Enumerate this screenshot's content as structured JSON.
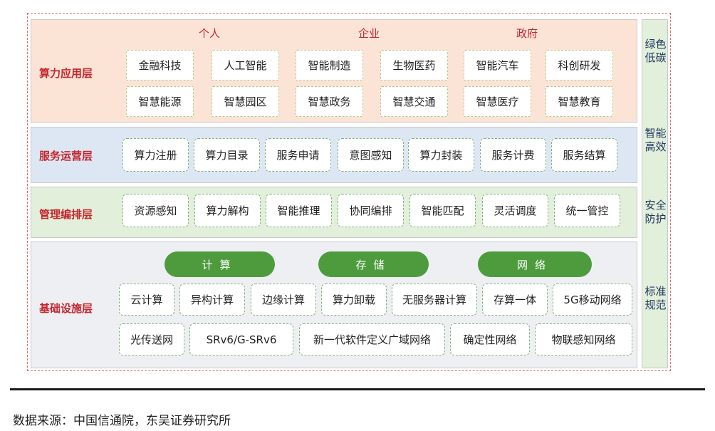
{
  "layers": {
    "application": {
      "label": "算力应用层",
      "groups": [
        "个人",
        "企业",
        "政府"
      ],
      "items": [
        "金融科技",
        "人工智能",
        "智能制造",
        "生物医药",
        "智能汽车",
        "科创研发",
        "智慧能源",
        "智慧园区",
        "智慧政务",
        "智慧交通",
        "智慧医疗",
        "智慧教育"
      ]
    },
    "service": {
      "label": "服务运营层",
      "items": [
        "算力注册",
        "算力目录",
        "服务申请",
        "意图感知",
        "算力封装",
        "服务计费",
        "服务结算"
      ]
    },
    "management": {
      "label": "管理编排层",
      "items": [
        "资源感知",
        "算力解构",
        "智能推理",
        "协同编排",
        "智能匹配",
        "灵活调度",
        "统一管控"
      ]
    },
    "infrastructure": {
      "label": "基础设施层",
      "pills": [
        "计算",
        "存储",
        "网络"
      ],
      "row1": [
        "云计算",
        "异构计算",
        "边缘计算",
        "算力卸载",
        "无服务器计算",
        "存算一体",
        "5G移动网络"
      ],
      "row2": [
        "光传送网",
        "SRv6/G-SRv6",
        "新一代软件定义广域网络",
        "确定性网络",
        "物联感知网络"
      ]
    }
  },
  "side": [
    "绿色低碳",
    "智能高效",
    "安全防护",
    "标准规范"
  ],
  "source": "数据来源：中国信通院，东吴证券研究所",
  "colors": {
    "label_red": "#c4262e",
    "pill_green": "#4e9b3e",
    "app_bg": "#fbe3d6",
    "service_bg": "#dde6f3",
    "mgmt_bg": "#e2efda",
    "infra_bg": "#eeeff2"
  }
}
